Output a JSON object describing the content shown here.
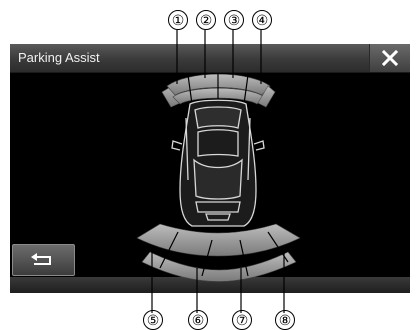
{
  "header": {
    "title": "Parking Assist"
  },
  "icons": {
    "close": "close-x-icon",
    "back": "return-arrow-icon"
  },
  "sensors": {
    "front": [
      {
        "label": "①"
      },
      {
        "label": "②"
      },
      {
        "label": "③"
      },
      {
        "label": "④"
      }
    ],
    "rear": [
      {
        "label": "⑤"
      },
      {
        "label": "⑥"
      },
      {
        "label": "⑦"
      },
      {
        "label": "⑧"
      }
    ]
  },
  "colors": {
    "background": "#000000",
    "zone": "#a8a8a8"
  }
}
